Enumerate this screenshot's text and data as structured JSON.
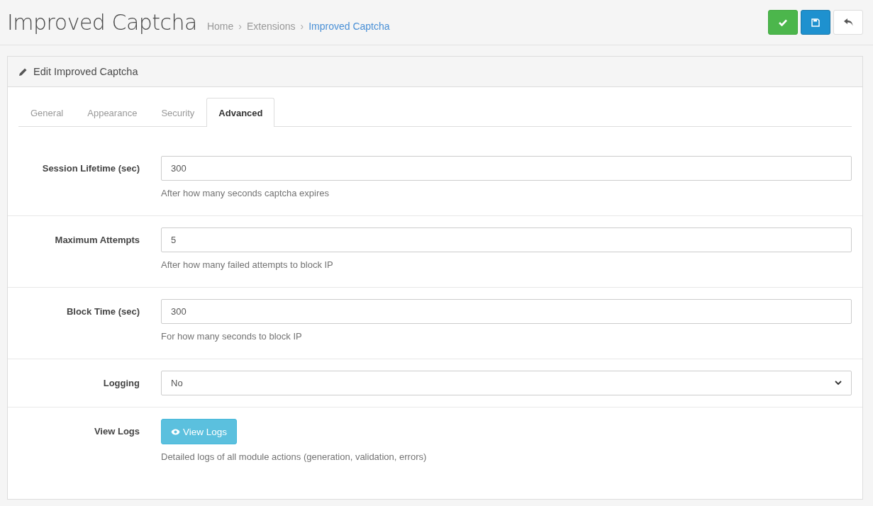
{
  "page": {
    "title": "Improved Captcha",
    "breadcrumbs": [
      {
        "label": "Home",
        "current": false
      },
      {
        "label": "Extensions",
        "current": false
      },
      {
        "label": "Improved Captcha",
        "current": true
      }
    ],
    "separator": "›",
    "actions": [
      {
        "kind": "check"
      },
      {
        "kind": "save"
      },
      {
        "kind": "back"
      }
    ]
  },
  "panel": {
    "title": "Edit Improved Captcha",
    "tabs": [
      {
        "label": "General",
        "selected": false
      },
      {
        "label": "Appearance",
        "selected": false
      },
      {
        "label": "Security",
        "selected": false
      },
      {
        "label": "Advanced",
        "selected": true
      }
    ],
    "fields": [
      {
        "kind": "input",
        "label": "Session Lifetime (sec)",
        "value": "300",
        "help": "After how many seconds captcha expires"
      },
      {
        "kind": "input",
        "label": "Maximum Attempts",
        "value": "5",
        "help": "After how many failed attempts to block IP"
      },
      {
        "kind": "input",
        "label": "Block Time (sec)",
        "value": "300",
        "help": "For how many seconds to block IP"
      },
      {
        "kind": "select",
        "label": "Logging",
        "value": "No"
      },
      {
        "kind": "button",
        "label": "View Logs",
        "button": "View Logs",
        "help": "Detailed logs of all module actions (generation, validation, errors)"
      }
    ]
  }
}
